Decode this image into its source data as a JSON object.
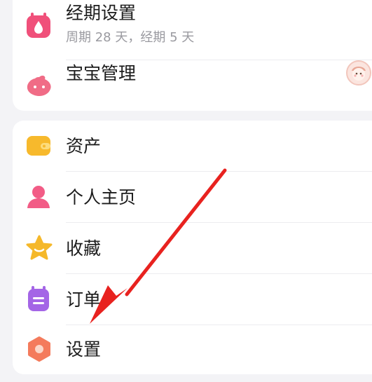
{
  "menu_top": {
    "period": {
      "label": "经期设置",
      "sublabel": "周期 28 天，经期 5 天",
      "icon": "calendar-drop-icon",
      "color": "#f0507a"
    },
    "baby": {
      "label": "宝宝管理",
      "icon": "baby-icon",
      "color": "#f06c86",
      "avatar_icon": "baby-avatar-icon"
    }
  },
  "menu_bottom": {
    "items": [
      {
        "label": "资产",
        "icon": "wallet-icon",
        "color": "#f7b92c"
      },
      {
        "label": "个人主页",
        "icon": "person-icon",
        "color": "#f25c86"
      },
      {
        "label": "收藏",
        "icon": "star-icon",
        "color": "#f5b82a"
      },
      {
        "label": "订单",
        "icon": "order-icon",
        "color": "#a465e6"
      },
      {
        "label": "设置",
        "icon": "gear-icon",
        "color": "#f47b5c"
      }
    ]
  },
  "annotation": {
    "arrow_color": "#e8221f",
    "icon": "red-arrow-annotation"
  }
}
